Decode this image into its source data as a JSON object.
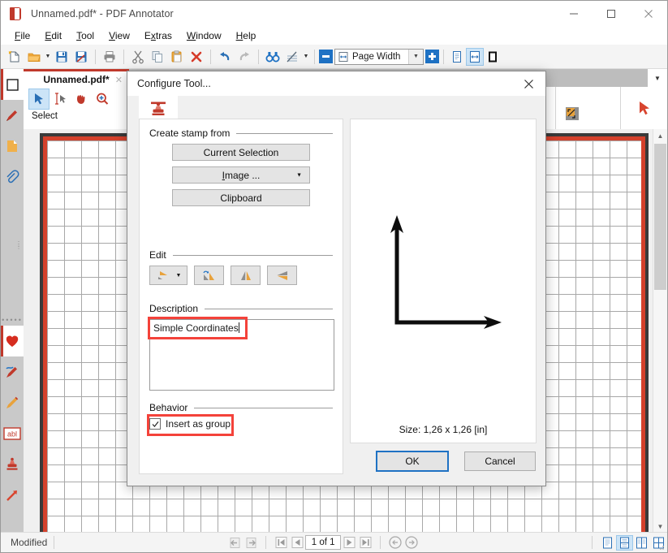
{
  "window": {
    "title": "Unnamed.pdf* - PDF Annotator",
    "icon": "pdf-annotator-icon",
    "minimize": "—",
    "maximize": "□",
    "close": "✕"
  },
  "menubar": {
    "items": [
      {
        "label": "File",
        "accel": "F"
      },
      {
        "label": "Edit",
        "accel": "E"
      },
      {
        "label": "Tool",
        "accel": "T"
      },
      {
        "label": "View",
        "accel": "V"
      },
      {
        "label": "Extras",
        "accel": "x"
      },
      {
        "label": "Window",
        "accel": "W"
      },
      {
        "label": "Help",
        "accel": "H"
      }
    ]
  },
  "toolbar": {
    "buttons": [
      {
        "name": "new-document",
        "icon": "new-page-icon"
      },
      {
        "name": "open-document",
        "icon": "open-folder-icon"
      },
      {
        "name": "open-dropdown",
        "icon": "chevron-down-icon"
      },
      {
        "name": "save",
        "icon": "save-disk-icon"
      },
      {
        "name": "save-as",
        "icon": "save-as-icon"
      },
      {
        "name": "print",
        "icon": "printer-icon"
      },
      {
        "name": "cut",
        "icon": "scissors-icon"
      },
      {
        "name": "copy",
        "icon": "copy-icon"
      },
      {
        "name": "paste",
        "icon": "paste-icon"
      },
      {
        "name": "delete",
        "icon": "red-x-icon"
      },
      {
        "name": "undo",
        "icon": "undo-arrow-icon"
      },
      {
        "name": "redo",
        "icon": "redo-arrow-icon"
      },
      {
        "name": "find",
        "icon": "binoculars-icon"
      },
      {
        "name": "erase-page",
        "icon": "erase-page-icon"
      },
      {
        "name": "erase-dropdown",
        "icon": "chevron-down-icon"
      }
    ],
    "zoom_out": "minus-icon",
    "zoom_in": "plus-icon",
    "zoom_value": "Page Width",
    "zoom_dropdown": "chevron-down-icon",
    "view_modes": [
      {
        "name": "single-page-view",
        "icon": "single-page-icon",
        "selected": false
      },
      {
        "name": "page-width-view",
        "icon": "page-width-icon",
        "selected": true
      },
      {
        "name": "fullscreen-view",
        "icon": "fullscreen-icon",
        "selected": false
      }
    ]
  },
  "rail": {
    "items": [
      {
        "name": "rail-item-select-rect",
        "icon": "empty-square-icon",
        "active": true
      },
      {
        "name": "rail-item-marker",
        "icon": "red-marker-icon",
        "active": false
      },
      {
        "name": "rail-item-note",
        "icon": "yellow-note-icon",
        "active": false
      },
      {
        "name": "rail-item-attachment",
        "icon": "paperclip-icon",
        "active": false
      },
      {
        "name": "rail-item-favorite",
        "icon": "red-heart-icon",
        "active": true
      },
      {
        "name": "rail-item-blue-pen",
        "icon": "blue-pen-icon",
        "active": false
      },
      {
        "name": "rail-item-highlighter",
        "icon": "orange-highlighter-icon",
        "active": false
      },
      {
        "name": "rail-item-text",
        "icon": "abl-text-icon",
        "active": false
      },
      {
        "name": "rail-item-stamp",
        "icon": "red-stamp-icon",
        "active": false
      },
      {
        "name": "rail-item-arrow",
        "icon": "red-arrow-icon",
        "active": false
      }
    ],
    "handle": "drag-dots"
  },
  "document_tab": {
    "label": "Unnamed.pdf*",
    "close": "✕",
    "overflow": "chevron-down-icon"
  },
  "annotation_toolbar": {
    "group_label": "Select",
    "tools": [
      {
        "name": "tool-select-arrow",
        "icon": "cursor-arrow-icon",
        "selected": true
      },
      {
        "name": "tool-text-select",
        "icon": "text-select-icon",
        "selected": false
      },
      {
        "name": "tool-pan-hand",
        "icon": "hand-icon",
        "selected": false
      },
      {
        "name": "tool-zoom",
        "icon": "magnifier-plus-icon",
        "selected": false
      },
      {
        "name": "tool-selection-area",
        "icon": "selection-area-icon",
        "selected": false
      }
    ],
    "right_tools": [
      {
        "name": "tool-resize",
        "icon": "resize-diagonal-icon"
      },
      {
        "name": "tool-pointer",
        "icon": "red-pointer-icon"
      }
    ]
  },
  "dialog": {
    "title": "Configure Tool...",
    "close": "✕",
    "tab_icon": "stamp-icon",
    "sections": {
      "create_from": {
        "label": "Create stamp from",
        "buttons": [
          {
            "name": "current-selection-button",
            "label": "Current Selection"
          },
          {
            "name": "image-button",
            "label": "Image ...",
            "has_dropdown": true
          },
          {
            "name": "clipboard-button",
            "label": "Clipboard"
          }
        ]
      },
      "edit": {
        "label": "Edit",
        "buttons": [
          {
            "name": "crop-button",
            "icon": "crop-icon",
            "has_dropdown": true
          },
          {
            "name": "rotate-button",
            "icon": "rotate-icon"
          },
          {
            "name": "flip-horizontal-button",
            "icon": "flip-horizontal-icon"
          },
          {
            "name": "flip-vertical-button",
            "icon": "flip-vertical-icon"
          }
        ]
      },
      "description": {
        "label": "Description",
        "value": "Simple Coordinates",
        "highlighted": true
      },
      "behavior": {
        "label": "Behavior",
        "checkbox_label": "Insert as group",
        "checked": true,
        "highlighted": true
      }
    },
    "preview": {
      "name": "stamp-preview",
      "content": "coordinate-axes-drawing",
      "size_label": "Size: 1,26 x 1,26 [in]"
    },
    "ok_label": "OK",
    "cancel_label": "Cancel"
  },
  "statusbar": {
    "status": "Modified",
    "nav": [
      {
        "name": "previous-view-button",
        "icon": "back-arrow-icon"
      },
      {
        "name": "next-view-button",
        "icon": "forward-arrow-icon"
      },
      {
        "name": "first-page-button",
        "icon": "first-page-icon"
      },
      {
        "name": "previous-page-button",
        "icon": "previous-page-icon"
      }
    ],
    "page_indicator": "1 of 1",
    "nav_after": [
      {
        "name": "next-page-button",
        "icon": "next-page-icon"
      },
      {
        "name": "last-page-button",
        "icon": "last-page-icon"
      },
      {
        "name": "history-back-button",
        "icon": "circle-back-icon"
      },
      {
        "name": "history-forward-button",
        "icon": "circle-forward-icon"
      }
    ],
    "layouts": [
      {
        "name": "layout-single",
        "icon": "layout-single-icon",
        "selected": false
      },
      {
        "name": "layout-continuous",
        "icon": "layout-continuous-icon",
        "selected": true
      },
      {
        "name": "layout-facing",
        "icon": "layout-facing-icon",
        "selected": false
      },
      {
        "name": "layout-grid",
        "icon": "layout-grid-icon",
        "selected": false
      }
    ]
  },
  "colors": {
    "accent_red": "#c0392b",
    "accent_blue": "#1f72c4",
    "highlight_red": "#f4423a",
    "selection_blue": "#cce4f7"
  }
}
